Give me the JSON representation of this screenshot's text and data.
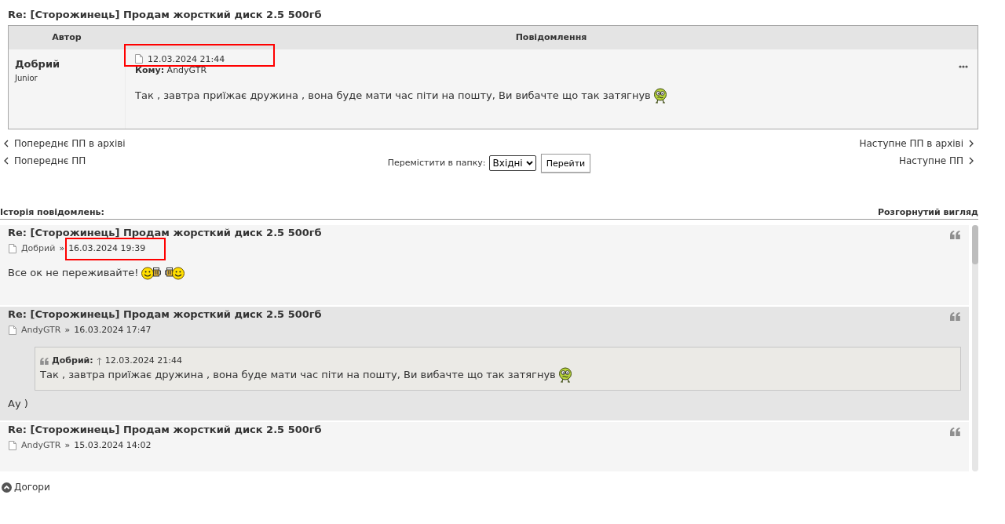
{
  "topic_title": "Re: [Сторожинець] Продам жорсткий диск 2.5 500гб",
  "message": {
    "columns": [
      "Автор",
      "Повідомлення"
    ],
    "author": "Добрий",
    "rank": "Junior",
    "date": "12.03.2024 21:44",
    "highlighted": true,
    "recipient": "**Кому:** AndyGTR",
    "body": "Так , завтра приїжає дружина , вона буде мати час піти на пошту, Ви вибачте що так затягнув",
    "emoticons": [
      {
        "kind": "nervous"
      }
    ]
  },
  "navigation": {
    "previous_archive": "Попереднє ПП в архіві",
    "previous": "Попереднє ПП",
    "next_archive": "Наступне ПП в архіві",
    "next": "Наступне ПП",
    "move_label": "Перемістити в папку:",
    "folder": "Вхідні",
    "go_button": "Перейти"
  },
  "history": {
    "title": "Історія повідомлень:",
    "view_link": "Розгорнутий вигляд",
    "entries": [
      {
        "title": "Re: [Сторожинець] Продам жорсткий диск 2.5 500гб",
        "author": "Добрий",
        "separator": "»",
        "date": "16.03.2024 19:39",
        "highlighted": true,
        "body": "Все ок не переживайте!",
        "emoticons": [
          {
            "kind": "smile-beer"
          },
          {
            "kind": "beer-smile"
          }
        ]
      },
      {
        "title": "Re: [Сторожинець] Продам жорсткий диск 2.5 500гб",
        "author": "AndyGTR",
        "separator": "»",
        "date": "16.03.2024 17:47",
        "highlighted": false,
        "quote": {
          "author": "Добрий:",
          "date": "12.03.2024 21:44",
          "body": "Так , завтра приїжає дружина , вона буде мати час піти на пошту, Ви вибачте що так затягнув",
          "emoticons": [
            {
              "kind": "nervous"
            }
          ]
        },
        "body": "Ау )"
      },
      {
        "title": "Re: [Сторожинець] Продам жорсткий диск 2.5 500гб",
        "author": "AndyGTR",
        "separator": "»",
        "date": "15.03.2024 14:02",
        "highlighted": false
      }
    ]
  },
  "back_to_top": "Догори"
}
